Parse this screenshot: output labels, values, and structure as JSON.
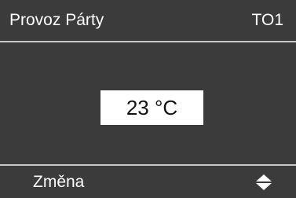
{
  "header": {
    "mode_title": "Provoz Párty",
    "circuit_code": "TO1"
  },
  "display": {
    "temperature": "23 °C"
  },
  "footer": {
    "action_label": "Změna",
    "adjust_icon": "up-down-arrows-icon"
  },
  "colors": {
    "screen_background": "#3b3b3b",
    "divider": "#c8c8c8",
    "value_box": "#ffffff",
    "text": "#ffffff"
  }
}
